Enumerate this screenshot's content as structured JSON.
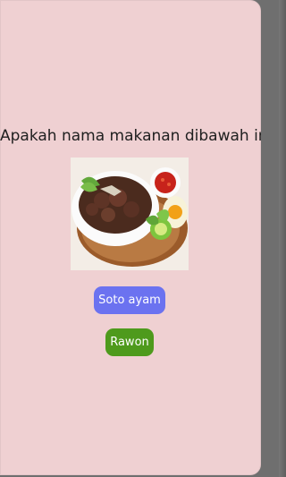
{
  "quiz": {
    "question": "Apakah nama makanan dibawah ini?",
    "image_icon": "food-image",
    "choices": [
      {
        "label": "Soto ayam",
        "color": "#6b72f0"
      },
      {
        "label": "Rawon",
        "color": "#4e9a1c"
      }
    ]
  },
  "colors": {
    "screen_background": "#efd0d2",
    "device_edge": "#6f6f6f",
    "text": "#1f1f1f"
  }
}
